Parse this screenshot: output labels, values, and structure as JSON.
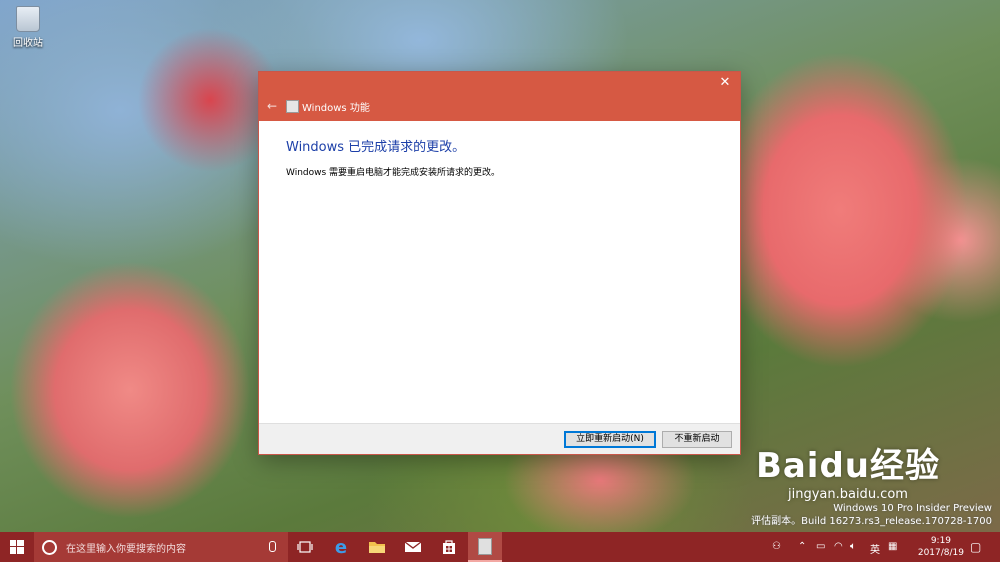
{
  "desktop": {
    "recycle_bin_label": "回收站",
    "watermark_line1": "Windows 10 Pro Insider Preview",
    "watermark_line2": "评估副本。Build 16273.rs3_release.170728-1700",
    "baidu_logo": "Baidu经验",
    "baidu_url": "jingyan.baidu.com"
  },
  "dialog": {
    "title": "Windows 功能",
    "heading": "Windows 已完成请求的更改。",
    "message": "Windows 需要重启电脑才能完成安装所请求的更改。",
    "restart_now_label": "立即重新启动(N)",
    "dont_restart_label": "不重新启动",
    "close_glyph": "✕",
    "back_glyph": "←"
  },
  "taskbar": {
    "search_placeholder": "在这里输入你要搜索的内容",
    "ime_label": "英",
    "time": "9:19",
    "date": "2017/8/19"
  },
  "colors": {
    "titlebar": "#d65943",
    "taskbar": "#8e2525",
    "heading_text": "#1c3fa8"
  }
}
